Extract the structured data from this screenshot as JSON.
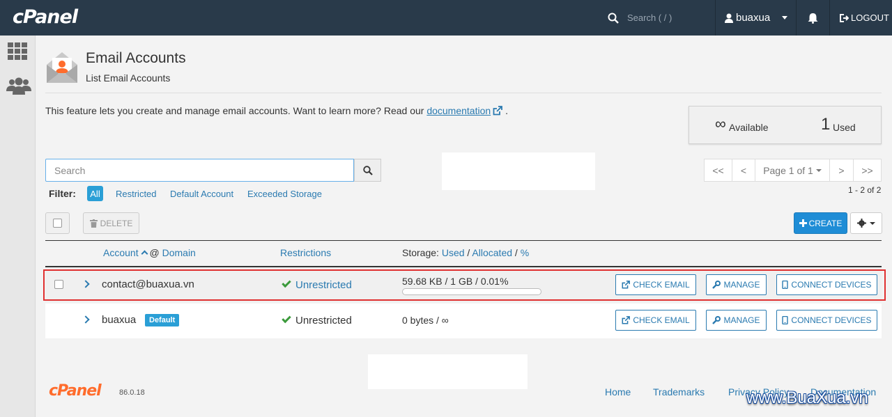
{
  "topbar": {
    "logo": "cPanel",
    "search_placeholder": "Search ( / )",
    "username": "buaxua",
    "logout": "LOGOUT"
  },
  "rail": {
    "icons": [
      "grid-icon",
      "users-icon"
    ]
  },
  "header": {
    "title": "Email Accounts",
    "subtitle": "List Email Accounts"
  },
  "intro": {
    "text": "This feature lets you create and manage email accounts. Want to learn more? Read our ",
    "link": "documentation",
    "end": "."
  },
  "stats": {
    "available_value": "∞",
    "available_label": "Available",
    "used_value": "1",
    "used_label": "Used"
  },
  "search": {
    "placeholder": "Search"
  },
  "filter": {
    "label": "Filter:",
    "options": [
      "All",
      "Restricted",
      "Default Account",
      "Exceeded Storage"
    ],
    "active": "All"
  },
  "pagination": {
    "first": "<<",
    "prev": "<",
    "page": "Page 1 of 1",
    "next": ">",
    "last": ">>",
    "count": "1 - 2 of 2"
  },
  "toolbar": {
    "delete": "DELETE",
    "create": "CREATE"
  },
  "table": {
    "col_account": "Account",
    "col_at": "@",
    "col_domain": "Domain",
    "col_restrictions": "Restrictions",
    "col_storage_prefix": "Storage:",
    "col_used": "Used",
    "sep1": "/",
    "col_allocated": "Allocated",
    "sep2": "/",
    "col_percent": "%",
    "rows": [
      {
        "account": "contact@buaxua.vn",
        "restriction": "Unrestricted",
        "storage": "59.68 KB / 1 GB / 0.01%",
        "usage_fraction": 0.0001
      },
      {
        "account": "buaxua",
        "badge": "Default",
        "restriction": "Unrestricted",
        "storage": "0 bytes / ∞"
      }
    ],
    "actions": {
      "check_email": "CHECK EMAIL",
      "manage": "MANAGE",
      "connect": "CONNECT DEVICES"
    }
  },
  "footer": {
    "logo": "cPanel",
    "version": "86.0.18",
    "links": [
      "Home",
      "Trademarks",
      "Privacy Policy",
      "Documentation"
    ],
    "watermark": "www.BuaXua.vn"
  },
  "colors": {
    "topbar": "#293a4a",
    "accent": "#2a7ab0",
    "create": "#1f8dd6",
    "brand_orange": "#ff6c2c",
    "highlight": "#e03030"
  }
}
